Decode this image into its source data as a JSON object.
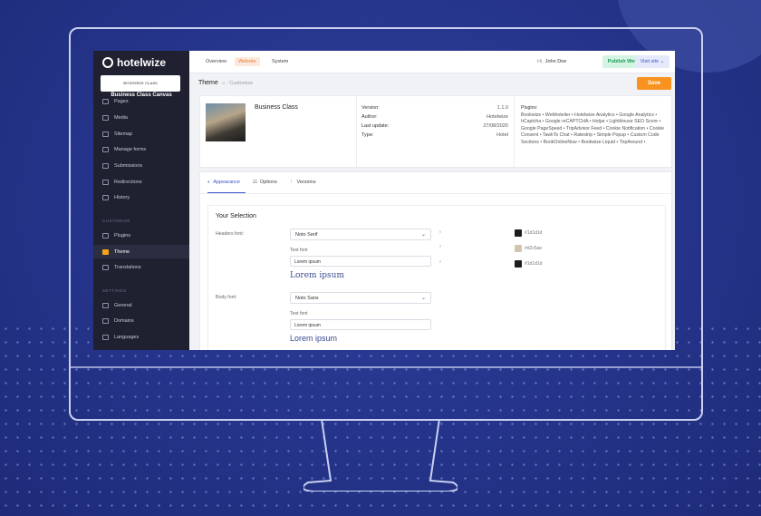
{
  "app": {
    "logo_text": "hotelwize"
  },
  "site": {
    "card_text": "BUSINESS CLASS",
    "name": "Business Class Canvas"
  },
  "sidebar": {
    "items": [
      {
        "label": "Pages",
        "icon": "pages-icon"
      },
      {
        "label": "Media",
        "icon": "media-icon"
      },
      {
        "label": "Sitemap",
        "icon": "sitemap-icon"
      },
      {
        "label": "Manage forms",
        "icon": "forms-icon"
      },
      {
        "label": "Submissions",
        "icon": "inbox-icon"
      },
      {
        "label": "Redirections",
        "icon": "redirect-icon"
      },
      {
        "label": "History",
        "icon": "history-icon"
      }
    ],
    "customize_header": "CUSTOMIZE",
    "customize_items": [
      {
        "label": "Plugins",
        "icon": "plugin-icon"
      },
      {
        "label": "Theme",
        "icon": "theme-icon",
        "active": true
      },
      {
        "label": "Translations",
        "icon": "translate-icon"
      }
    ],
    "settings_header": "SETTINGS",
    "settings_items": [
      {
        "label": "General",
        "icon": "gear-icon"
      },
      {
        "label": "Domains",
        "icon": "link-icon"
      },
      {
        "label": "Languages",
        "icon": "globe-icon"
      }
    ]
  },
  "topbar": {
    "tabs": [
      "Overview",
      "Website",
      "System"
    ],
    "active_tab": "Website",
    "greeting": "Hi,",
    "user": "John Doe",
    "publish_label": "Publish Website",
    "visit_label": "Visit site"
  },
  "page": {
    "title": "Theme",
    "breadcrumb": "Customize",
    "save_label": "Save"
  },
  "theme": {
    "name": "Business Class",
    "meta": [
      {
        "key": "Version:",
        "value": "1.1.0"
      },
      {
        "key": "Author:",
        "value": "Hotelwize"
      },
      {
        "key": "Last update:",
        "value": "27/08/2020"
      },
      {
        "key": "Type:",
        "value": "Hotel"
      }
    ],
    "plugins_label": "Plugins:",
    "plugins_text": "Bookwize • Webhotelier • Hotelwize Analytics • Google Analytics • hCaptcha • Google reCAPTCHA • Hotjar • LightHouse SEO Score • Google PageSpeed • TripAdvisor Feed • Cookie Notification • Cookie Consent • TawkTo Chat • Ratestrip • Simple Popup • Custom Code Sections • BookOnlineNow • Bookwize Liquid • TripAround •"
  },
  "content_tabs": [
    "Appearance",
    "Options",
    "Versions"
  ],
  "selection": {
    "title": "Your Selection",
    "headers_font_label": "Headers font:",
    "headers_font_value": "Noto Serif",
    "body_font_label": "Body font:",
    "body_font_value": "Noto Sans",
    "test_font_label": "Test font",
    "test_input_value": "Lorem ipsum",
    "preview_text": "Lorem ipsum",
    "colors": [
      {
        "hex": "#1d1d1d",
        "color": "#1d1d1d"
      },
      {
        "hex": "#d2c5ae",
        "color": "#d2c5ae"
      },
      {
        "hex": "#1d1d1d",
        "color": "#1d1d1d"
      }
    ]
  },
  "colors": {
    "accent": "#f7931e",
    "primary": "#3d54c9",
    "sidebar_bg": "#1f2130",
    "page_bg": "#25348a"
  }
}
